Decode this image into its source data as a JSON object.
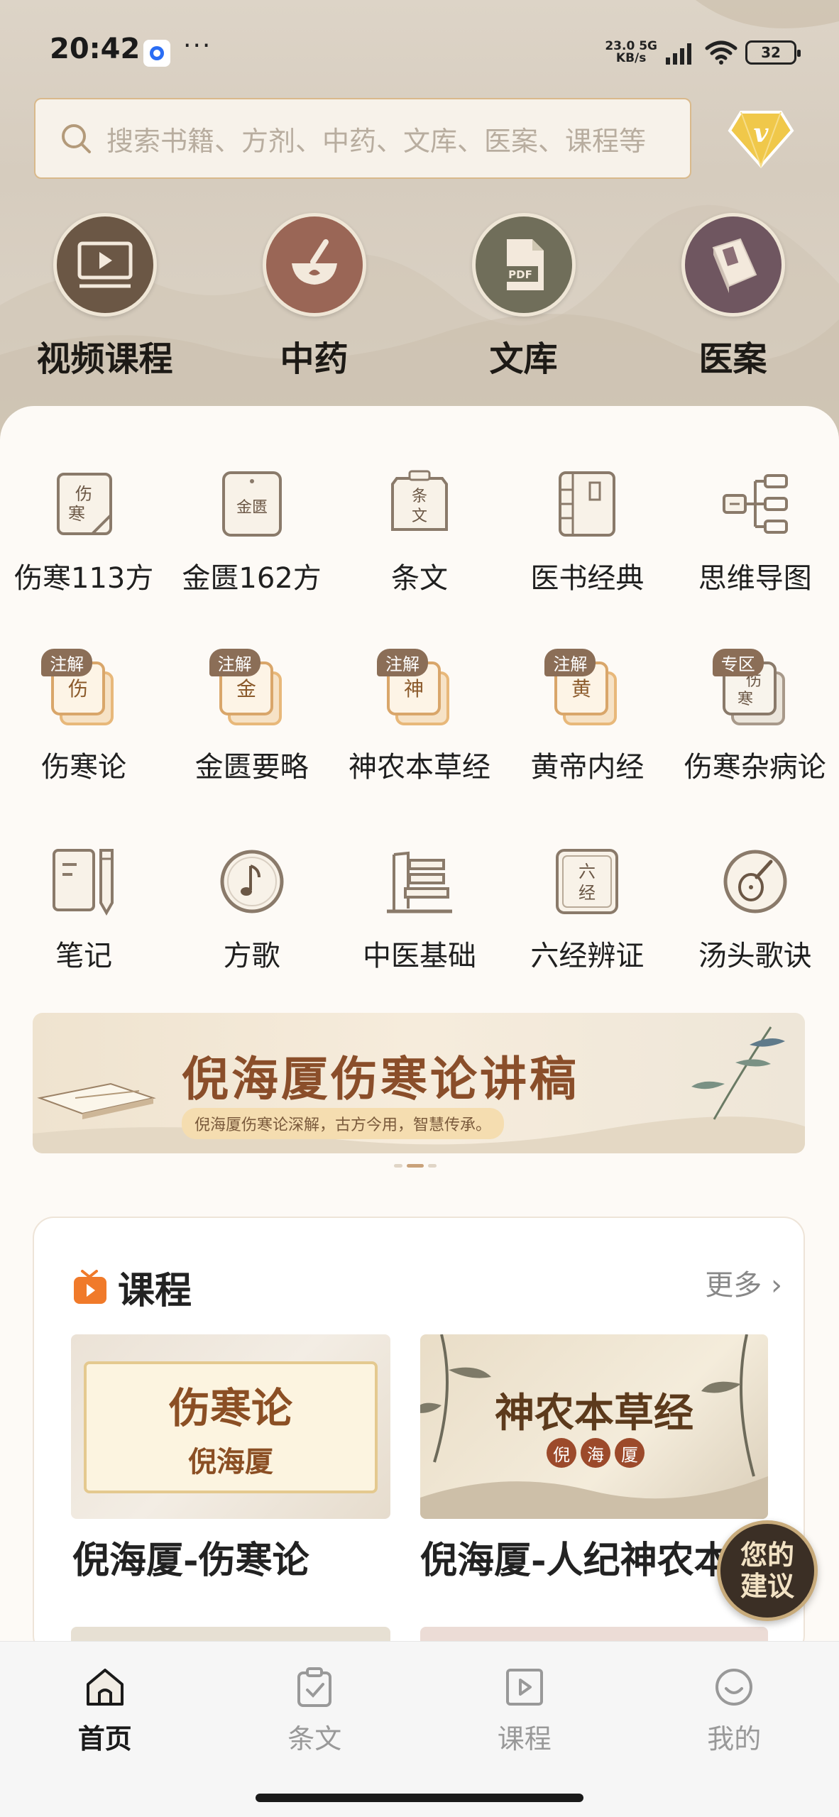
{
  "status_bar": {
    "time": "20:42",
    "dots": "···",
    "net_speed": "23.0",
    "net_unit": "KB/s",
    "net_type": "5G",
    "battery": "32"
  },
  "search": {
    "placeholder": "搜索书籍、方剂、中药、文库、医案、课程等"
  },
  "top_nav": [
    {
      "label": "视频课程",
      "icon": "video-icon",
      "color": "#6b5745"
    },
    {
      "label": "中药",
      "icon": "mortar-icon",
      "color": "#9a6656"
    },
    {
      "label": "文库",
      "icon": "pdf-icon",
      "color": "#706e5a"
    },
    {
      "label": "医案",
      "icon": "book-icon",
      "color": "#6f5660"
    }
  ],
  "grid": {
    "row1": [
      {
        "label": "伤寒113方",
        "glyph": "伤\n寒"
      },
      {
        "label": "金匮162方",
        "glyph": "金匮"
      },
      {
        "label": "条文",
        "glyph": "条\n文"
      },
      {
        "label": "医书经典",
        "glyph": ""
      },
      {
        "label": "思维导图",
        "glyph": ""
      }
    ],
    "row2": [
      {
        "label": "伤寒论",
        "glyph": "伤",
        "tag": "注解"
      },
      {
        "label": "金匮要略",
        "glyph": "金",
        "tag": "注解"
      },
      {
        "label": "神农本草经",
        "glyph": "神",
        "tag": "注解"
      },
      {
        "label": "黄帝内经",
        "glyph": "黄",
        "tag": "注解"
      },
      {
        "label": "伤寒杂病论",
        "glyph": "伤\n寒",
        "tag": "专区"
      }
    ],
    "row3": [
      {
        "label": "笔记",
        "glyph": ""
      },
      {
        "label": "方歌",
        "glyph": "♪"
      },
      {
        "label": "中医基础",
        "glyph": ""
      },
      {
        "label": "六经辨证",
        "glyph": "六\n经"
      },
      {
        "label": "汤头歌诀",
        "glyph": ""
      }
    ]
  },
  "banner": {
    "title": "倪海厦伤寒论讲稿",
    "subtitle": "倪海厦伤寒论深解，古方今用，智慧传承。"
  },
  "course": {
    "title": "课程",
    "more": "更多 ›",
    "cards": [
      {
        "cover_title": "伤寒论",
        "cover_sub": "倪海厦",
        "caption": "倪海厦-伤寒论"
      },
      {
        "cover_title": "神农本草经",
        "seals": [
          "倪",
          "海",
          "厦"
        ],
        "caption": "倪海厦-人纪神农本草经"
      }
    ]
  },
  "fab": {
    "line1": "您的",
    "line2": "建议"
  },
  "tabbar": [
    {
      "label": "首页",
      "active": true
    },
    {
      "label": "条文",
      "active": false
    },
    {
      "label": "课程",
      "active": false
    },
    {
      "label": "我的",
      "active": false
    }
  ],
  "colors": {
    "accent_brown": "#8b6e57",
    "panel_bg": "#fdfaf6",
    "icon_stroke": "#8a7a6a"
  }
}
